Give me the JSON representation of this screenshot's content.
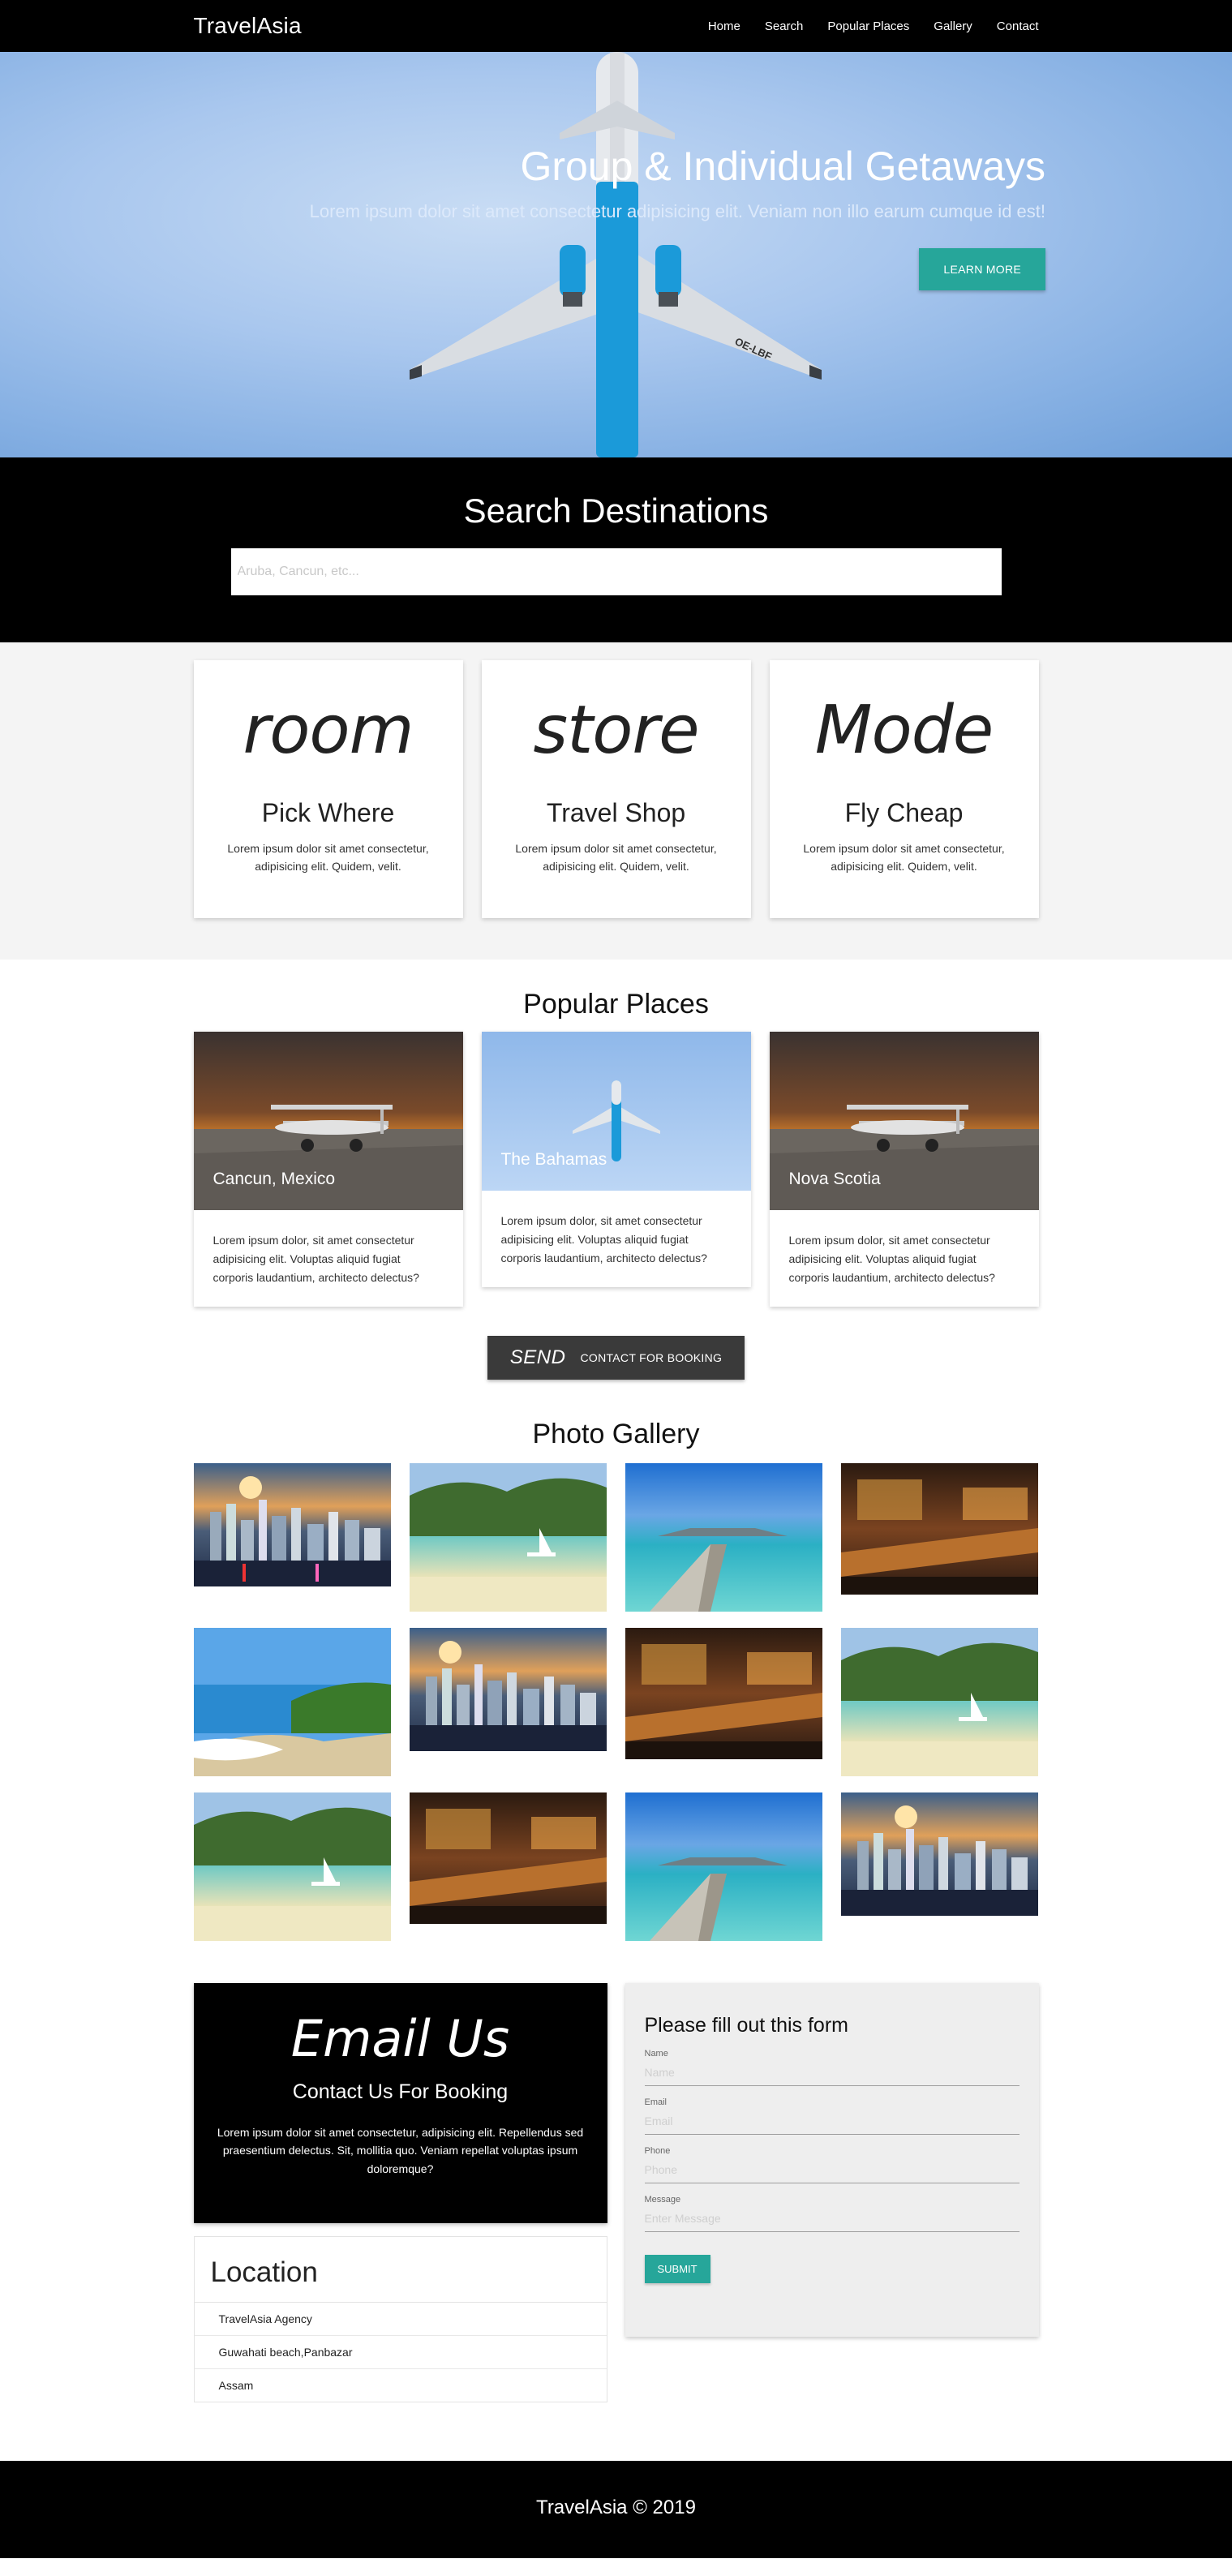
{
  "nav": {
    "brand": "TravelAsia",
    "items": [
      "Home",
      "Search",
      "Popular Places",
      "Gallery",
      "Contact"
    ]
  },
  "hero": {
    "title": "Group & Individual Getaways",
    "subtitle": "Lorem ipsum dolor sit amet consectetur adipisicing elit. Veniam non illo earum cumque id est!",
    "button": "Learn More",
    "plane_tail_text": "OE-LBF"
  },
  "search": {
    "title": "Search Destinations",
    "placeholder": "Aruba, Cancun, etc..."
  },
  "features": [
    {
      "icon_text": "room",
      "title": "Pick Where",
      "text": "Lorem ipsum dolor sit amet consectetur, adipisicing elit. Quidem, velit."
    },
    {
      "icon_text": "store",
      "title": "Travel Shop",
      "text": "Lorem ipsum dolor sit amet consectetur, adipisicing elit. Quidem, velit."
    },
    {
      "icon_text": "Mode",
      "title": "Fly Cheap",
      "text": "Lorem ipsum dolor sit amet consectetur, adipisicing elit. Quidem, velit."
    }
  ],
  "popular": {
    "title": "Popular Places",
    "places": [
      {
        "caption": "Cancun, Mexico",
        "text": "Lorem ipsum dolor, sit amet consectetur adipisicing elit. Voluptas aliquid fugiat corporis laudantium, architecto delectus?"
      },
      {
        "caption": "The Bahamas",
        "text": "Lorem ipsum dolor, sit amet consectetur adipisicing elit. Voluptas aliquid fugiat corporis laudantium, architecto delectus?"
      },
      {
        "caption": "Nova Scotia",
        "text": "Lorem ipsum dolor, sit amet consectetur adipisicing elit. Voluptas aliquid fugiat corporis laudantium, architecto delectus?"
      }
    ],
    "button_icon": "SEND",
    "button_label": "Contact For Booking"
  },
  "gallery": {
    "title": "Photo Gallery",
    "images": [
      "city-sunset",
      "beach-boat",
      "pier",
      "bar",
      "palm-beach",
      "city-sunset",
      "bar",
      "beach-boat",
      "beach-boat",
      "bar",
      "pier",
      "city-sunset"
    ]
  },
  "contact": {
    "email_icon": "Email Us",
    "heading": "Contact Us For Booking",
    "text": "Lorem ipsum dolor sit amet consectetur, adipisicing elit. Repellendus sed praesentium delectus. Sit, mollitia quo. Veniam repellat voluptas ipsum doloremque?",
    "location_title": "Location",
    "location_items": [
      "TravelAsia Agency",
      "Guwahati beach,Panbazar",
      "Assam"
    ],
    "form_title": "Please fill out this form",
    "fields": [
      {
        "label": "Name",
        "placeholder": "Name"
      },
      {
        "label": "Email",
        "placeholder": "Email"
      },
      {
        "label": "Phone",
        "placeholder": "Phone"
      },
      {
        "label": "Message",
        "placeholder": "Enter Message"
      }
    ],
    "submit": "Submit"
  },
  "footer": {
    "text": "TravelAsia © 2019"
  },
  "colors": {
    "accent": "#26a69a",
    "dark": "#000000",
    "button_dark": "#3a3a3a"
  }
}
